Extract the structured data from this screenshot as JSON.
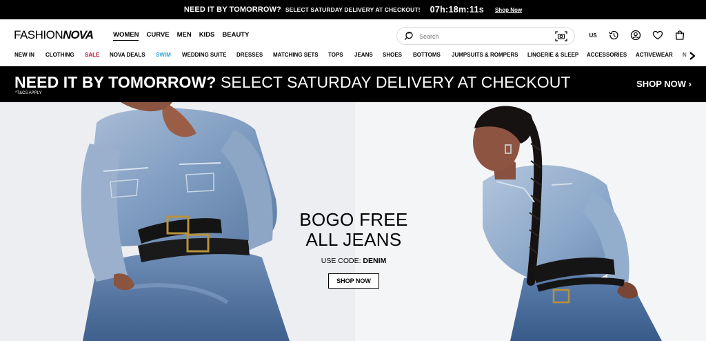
{
  "announcement": {
    "headline": "NEED IT BY TOMORROW?",
    "subtext": "SELECT SATURDAY DELIVERY AT CHECKOUT!",
    "timer": "07h:18m:11s",
    "link": "Shop Now"
  },
  "header": {
    "logo_light": "FASHION",
    "logo_bold": "NOVA",
    "main_categories": [
      "WOMEN",
      "CURVE",
      "MEN",
      "KIDS",
      "BEAUTY"
    ],
    "active_category": "WOMEN",
    "search_placeholder": "Search",
    "region": "US",
    "icons": [
      "history-icon",
      "account-icon",
      "wishlist-heart-icon",
      "shopping-bag-icon"
    ]
  },
  "nav": {
    "items": [
      "NEW IN",
      "CLOTHING",
      "SALE",
      "NOVA DEALS",
      "SWIM",
      "WEDDING SUITE",
      "DRESSES",
      "MATCHING SETS",
      "TOPS",
      "JEANS",
      "SHOES",
      "BOTTOMS",
      "JUMPSUITS & ROMPERS",
      "LINGERIE & SLEEP",
      "ACCESSORIES",
      "ACTIVEWEAR",
      "N"
    ],
    "colors": {
      "SALE": "#c8102e",
      "SWIM": "#3aa6d8"
    }
  },
  "promo": {
    "bold": "NEED IT BY TOMORROW?",
    "rest": " SELECT SATURDAY DELIVERY AT CHECKOUT",
    "terms": "*T&CS APPLY",
    "cta": "SHOP NOW ›"
  },
  "hero": {
    "line1": "BOGO FREE",
    "line2": "ALL JEANS",
    "code_label": "USE CODE: ",
    "code": "DENIM",
    "cta": "SHOP NOW"
  },
  "colors": {
    "accent": "#000000",
    "sale": "#c8102e",
    "swim": "#3aa6d8"
  }
}
